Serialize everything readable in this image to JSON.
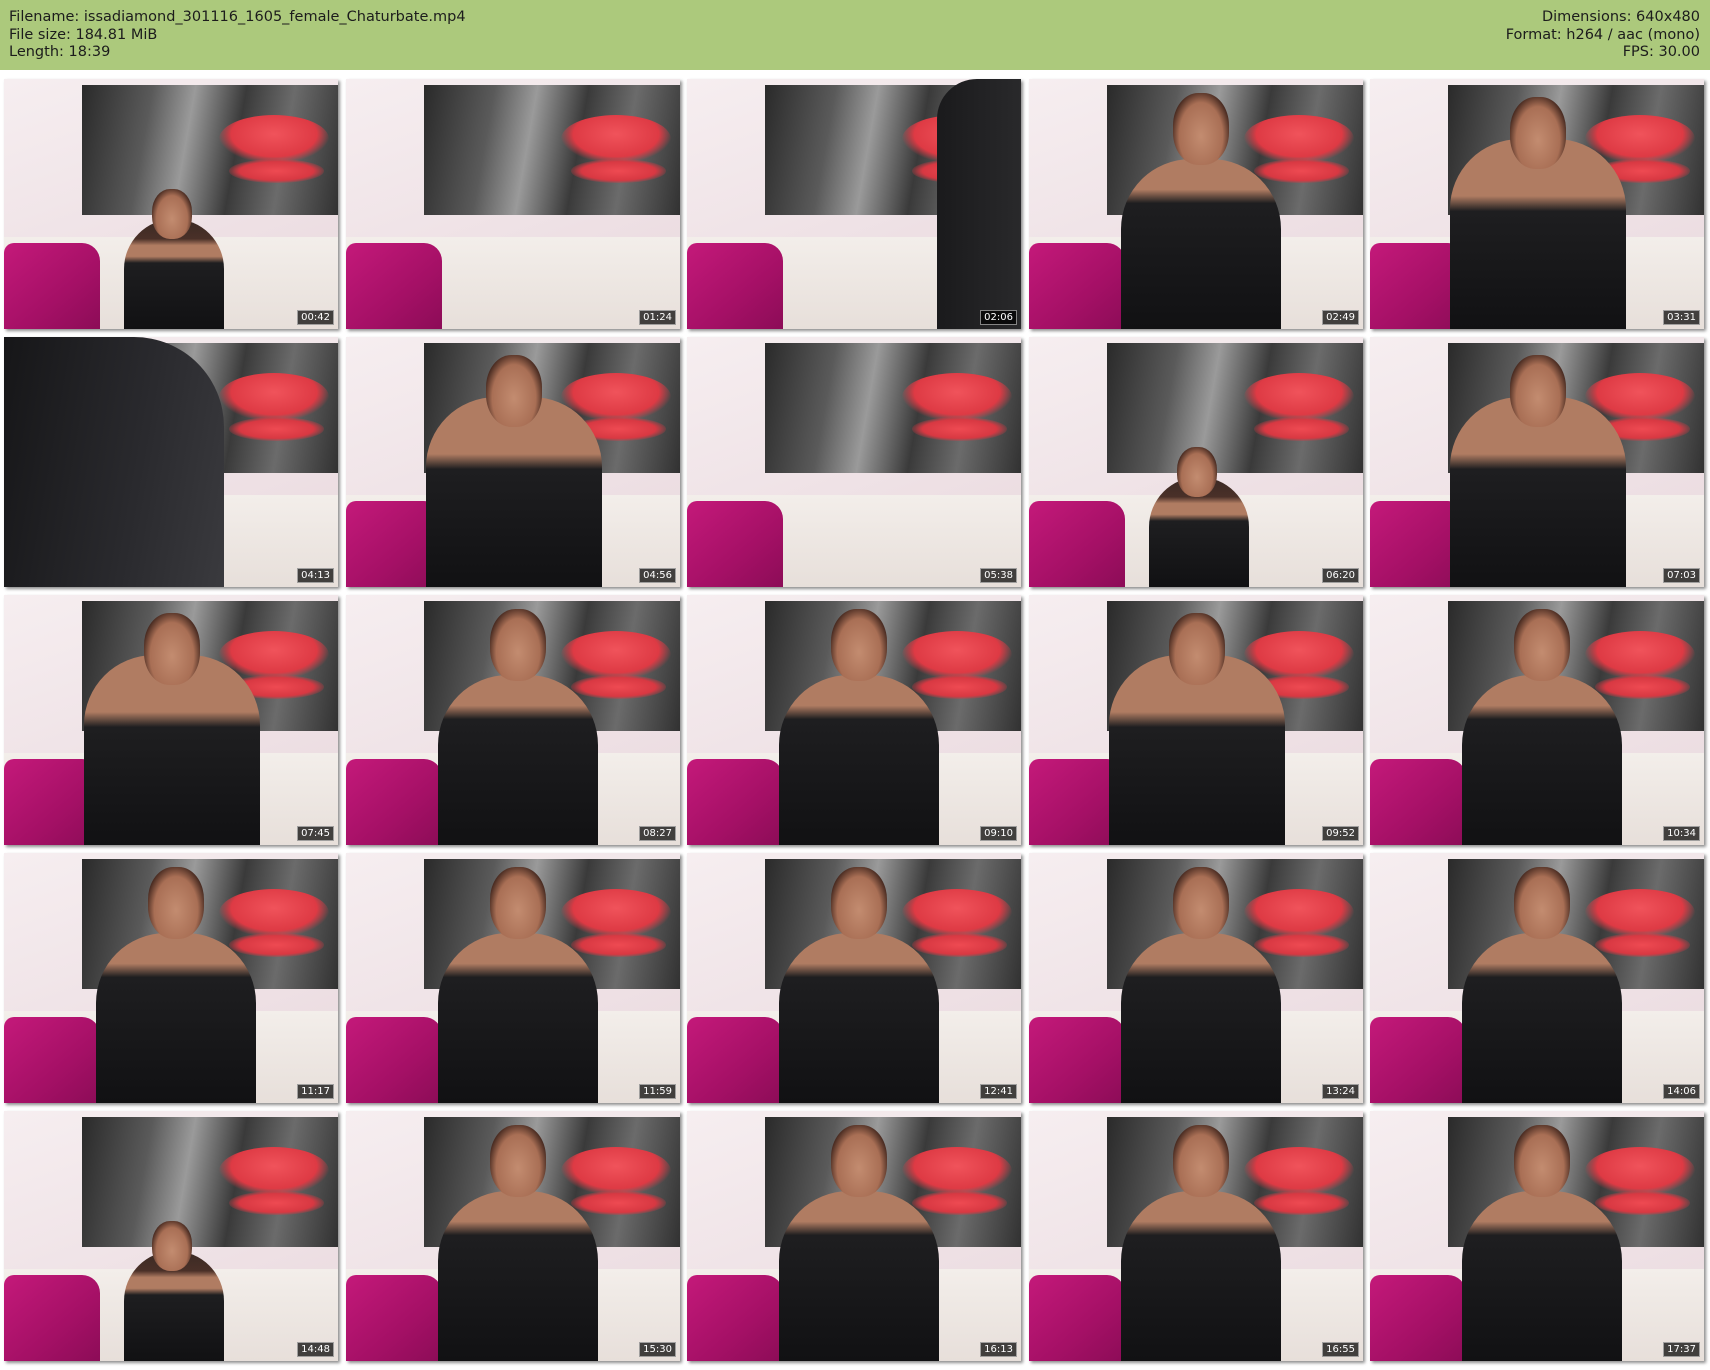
{
  "header": {
    "filename": "Filename: issadiamond_301116_1605_female_Chaturbate.mp4",
    "filesize": "File size: 184.81 MiB",
    "length": "Length: 18:39",
    "dimensions": "Dimensions: 640x480",
    "format": "Format: h264 / aac (mono)",
    "fps": "FPS: 30.00"
  },
  "thumbnails": [
    {
      "timestamp": "00:42",
      "figure": "seated-small"
    },
    {
      "timestamp": "01:24",
      "figure": "none"
    },
    {
      "timestamp": "02:06",
      "figure": "blur-right"
    },
    {
      "timestamp": "02:49",
      "figure": "center"
    },
    {
      "timestamp": "03:31",
      "figure": "center-arms-up"
    },
    {
      "timestamp": "04:13",
      "figure": "blur-left"
    },
    {
      "timestamp": "04:56",
      "figure": "center-arms-up"
    },
    {
      "timestamp": "05:38",
      "figure": "none"
    },
    {
      "timestamp": "06:20",
      "figure": "seated-small"
    },
    {
      "timestamp": "07:03",
      "figure": "center-arms-up"
    },
    {
      "timestamp": "07:45",
      "figure": "center-arms-up"
    },
    {
      "timestamp": "08:27",
      "figure": "center"
    },
    {
      "timestamp": "09:10",
      "figure": "center"
    },
    {
      "timestamp": "09:52",
      "figure": "center-arms-up"
    },
    {
      "timestamp": "10:34",
      "figure": "center"
    },
    {
      "timestamp": "11:17",
      "figure": "center"
    },
    {
      "timestamp": "11:59",
      "figure": "center"
    },
    {
      "timestamp": "12:41",
      "figure": "center"
    },
    {
      "timestamp": "13:24",
      "figure": "center"
    },
    {
      "timestamp": "14:06",
      "figure": "center"
    },
    {
      "timestamp": "14:48",
      "figure": "seated-small"
    },
    {
      "timestamp": "15:30",
      "figure": "center"
    },
    {
      "timestamp": "16:13",
      "figure": "center"
    },
    {
      "timestamp": "16:55",
      "figure": "center"
    },
    {
      "timestamp": "17:37",
      "figure": "center"
    }
  ],
  "colors": {
    "header_bg": "#acc97c",
    "pillow": "#c4197a",
    "lips": "#de3a44"
  }
}
